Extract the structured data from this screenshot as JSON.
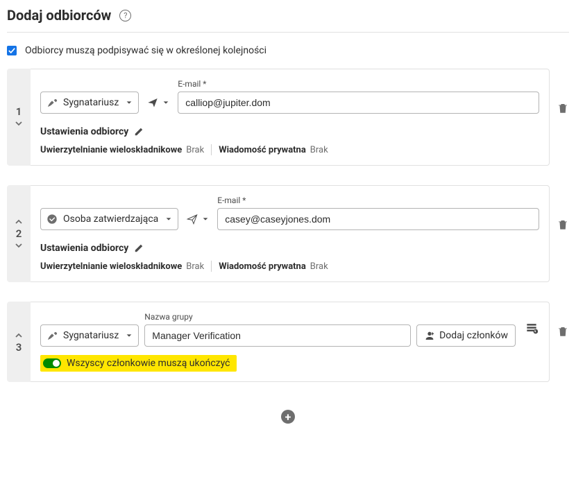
{
  "header": {
    "title": "Dodaj odbiorców"
  },
  "order_checkbox": {
    "label": "Odbiorcy muszą podpisywać się w określonej kolejności",
    "checked": true
  },
  "recipients": [
    {
      "index": "1",
      "role": "Sygnatariusz",
      "email_label": "E-mail",
      "email": "calliop@jupiter.dom",
      "settings_label": "Ustawienia odbiorcy",
      "mfa_label": "Uwierzytelnianie wieloskładnikowe",
      "mfa_value": "Brak",
      "pm_label": "Wiadomość prywatna",
      "pm_value": "Brak"
    },
    {
      "index": "2",
      "role": "Osoba zatwierdzająca",
      "email_label": "E-mail",
      "email": "casey@caseyjones.dom",
      "settings_label": "Ustawienia odbiorcy",
      "mfa_label": "Uwierzytelnianie wieloskładnikowe",
      "mfa_value": "Brak",
      "pm_label": "Wiadomość prywatna",
      "pm_value": "Brak"
    }
  ],
  "group": {
    "index": "3",
    "role": "Sygnatariusz",
    "name_label": "Nazwa grupy",
    "name": "Manager Verification",
    "add_members": "Dodaj członków",
    "toggle_label": "Wszyscy członkowie muszą ukończyć",
    "toggle_on": true
  }
}
